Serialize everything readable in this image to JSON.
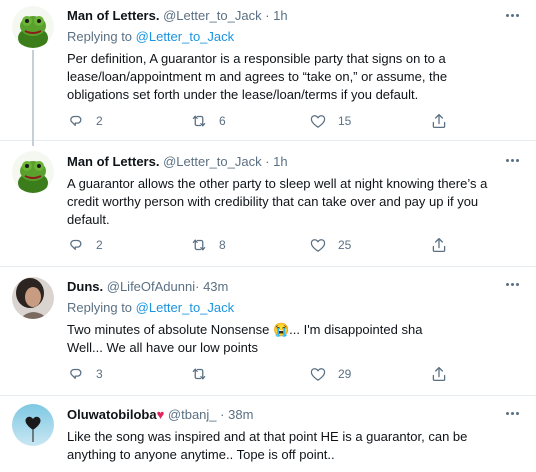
{
  "tweets": [
    {
      "name": "Man of Letters.",
      "handle": "@Letter_to_Jack",
      "dot": "·",
      "time": "1h",
      "replying_prefix": "Replying to ",
      "replying_to": "@Letter_to_Jack",
      "lines": [
        "Per definition, A guarantor is a responsible party that signs on to a",
        "lease/loan/appointment m and agrees to “take on,” or assume, the",
        "obligations set forth under the lease/loan/terms if you default."
      ],
      "replies": "2",
      "retweets": "6",
      "likes": "15"
    },
    {
      "name": "Man of Letters.",
      "handle": "@Letter_to_Jack",
      "dot": "·",
      "time": "1h",
      "lines": [
        "A guarantor allows the other party to sleep well at night knowing there’s a",
        "credit worthy person with  credibility that can take over and pay up if you",
        "default."
      ],
      "replies": "2",
      "retweets": "8",
      "likes": "25"
    },
    {
      "name": "Duns.",
      "handle": "@LifeOfAdunni",
      "dot": "·",
      "time": "43m",
      "replying_prefix": "Replying to ",
      "replying_to": "@Letter_to_Jack",
      "line1_before": "Two minutes of absolute Nonsense ",
      "emoji": "😭",
      "line1_after": "... I'm disappointed sha",
      "line2": "Well... We all have our low points",
      "replies": "3",
      "retweets": "",
      "likes": "29"
    },
    {
      "name": "Oluwatobiloba",
      "name_emoji": "♥",
      "handle": "@tbanj_",
      "dot": "·",
      "time": "38m",
      "lines": [
        "Like the song was inspired and at that point HE is a guarantor, can be",
        "anything to anyone anytime.. Tope is off point.."
      ]
    }
  ],
  "colors": {
    "link": "#1b95e0",
    "secondary": "#5b7083",
    "divider": "#e6ecf0",
    "heart": "#e0245e"
  },
  "icons": [
    "reply-icon",
    "retweet-icon",
    "like-icon",
    "share-icon",
    "more-icon"
  ]
}
